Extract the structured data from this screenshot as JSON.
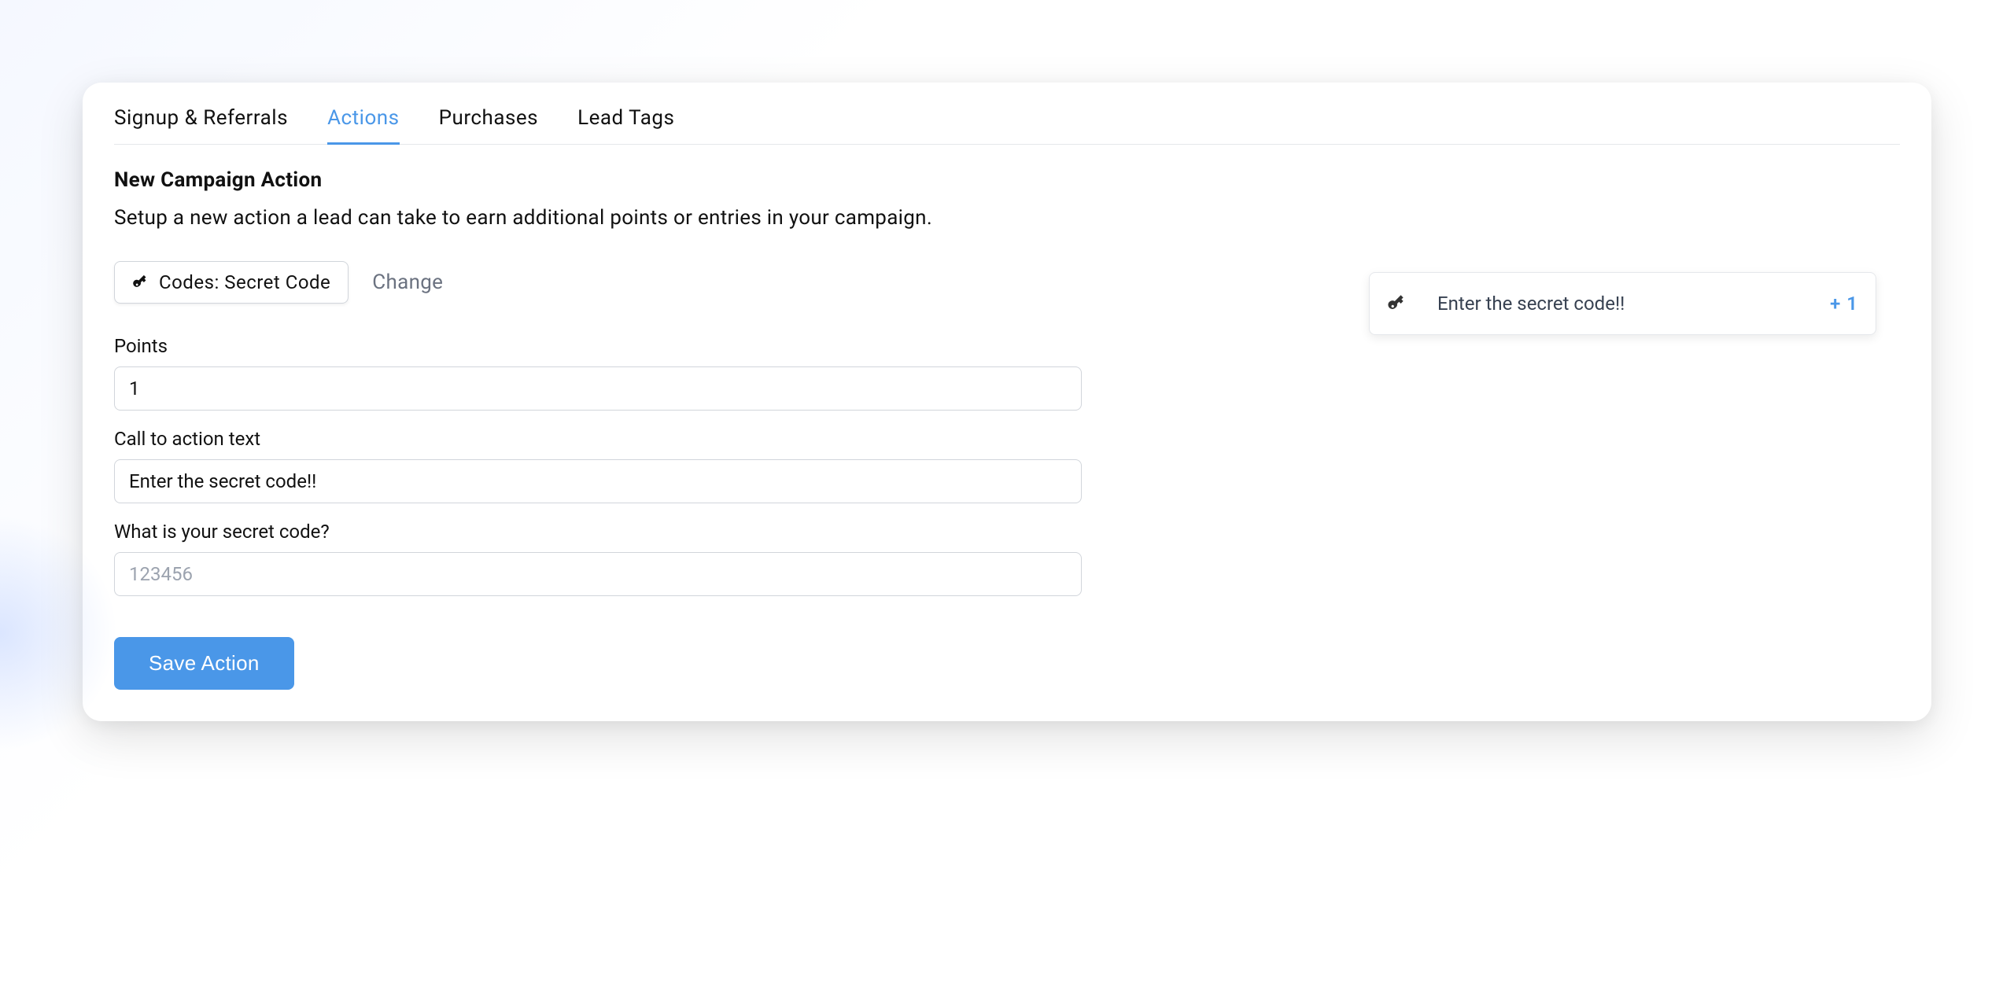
{
  "tabs": [
    {
      "label": "Signup & Referrals",
      "active": false
    },
    {
      "label": "Actions",
      "active": true
    },
    {
      "label": "Purchases",
      "active": false
    },
    {
      "label": "Lead Tags",
      "active": false
    }
  ],
  "section": {
    "title": "New Campaign Action",
    "description": "Setup a new action a lead can take to earn additional points or entries in your campaign."
  },
  "action_type": {
    "label": "Codes: Secret Code",
    "change_label": "Change"
  },
  "form": {
    "points": {
      "label": "Points",
      "value": "1"
    },
    "cta": {
      "label": "Call to action text",
      "value": "Enter the secret code!!"
    },
    "secret": {
      "label": "What is your secret code?",
      "placeholder": "123456",
      "value": ""
    }
  },
  "save_button": "Save Action",
  "preview": {
    "text": "Enter the secret code!!",
    "points_display": "+ 1"
  }
}
